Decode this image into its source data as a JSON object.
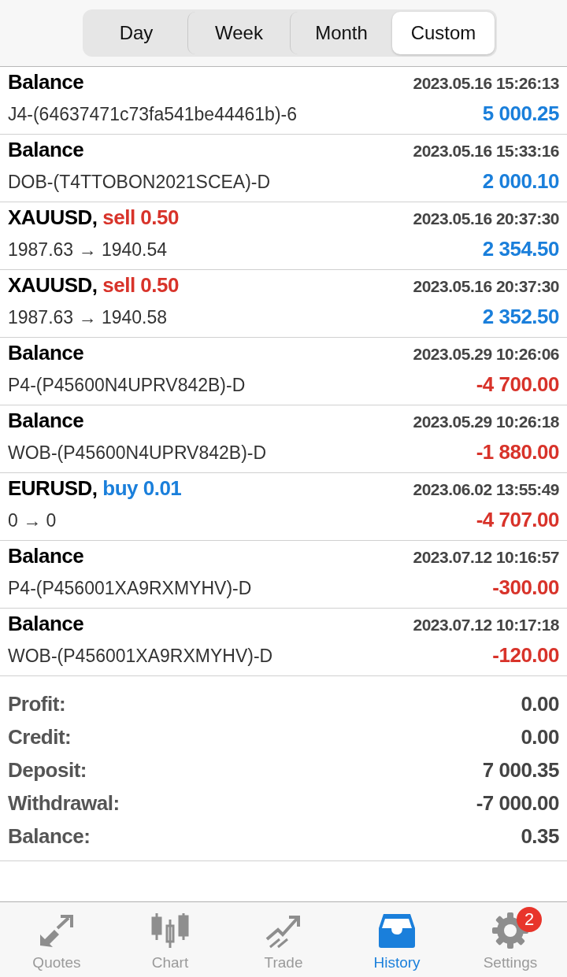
{
  "period_tabs": [
    {
      "label": "Day",
      "selected": false
    },
    {
      "label": "Week",
      "selected": false
    },
    {
      "label": "Month",
      "selected": false
    },
    {
      "label": "Custom",
      "selected": true
    }
  ],
  "deals": [
    {
      "title": "Balance",
      "time": "2023.05.16 15:26:13",
      "comment": "J4-(64637471c73fa541be44461b)-6",
      "amount": "5 000.25",
      "negative": false
    },
    {
      "title": "Balance",
      "time": "2023.05.16 15:33:16",
      "comment": "DOB-(T4TTOBON2021SCEA)-D",
      "amount": "2 000.10",
      "negative": false
    },
    {
      "title": "XAUUSD,",
      "order": {
        "sell": true,
        "text": "sell 0.50"
      },
      "time": "2023.05.16 20:37:30",
      "comment": "1987.63 → 1940.54",
      "amount": "2 354.50",
      "negative": false
    },
    {
      "title": "XAUUSD,",
      "order": {
        "sell": true,
        "text": "sell 0.50"
      },
      "time": "2023.05.16 20:37:30",
      "comment": "1987.63 → 1940.58",
      "amount": "2 352.50",
      "negative": false
    },
    {
      "title": "Balance",
      "time": "2023.05.29 10:26:06",
      "comment": "P4-(P45600N4UPRV842B)-D",
      "amount": "-4 700.00",
      "negative": true
    },
    {
      "title": "Balance",
      "time": "2023.05.29 10:26:18",
      "comment": "WOB-(P45600N4UPRV842B)-D",
      "amount": "-1 880.00",
      "negative": true
    },
    {
      "title": "EURUSD,",
      "order": {
        "sell": false,
        "text": "buy 0.01"
      },
      "time": "2023.06.02 13:55:49",
      "comment": "0 → 0",
      "amount": "-4 707.00",
      "negative": true
    },
    {
      "title": "Balance",
      "time": "2023.07.12 10:16:57",
      "comment": "P4-(P456001XA9RXMYHV)-D",
      "amount": "-300.00",
      "negative": true
    },
    {
      "title": "Balance",
      "time": "2023.07.12 10:17:18",
      "comment": "WOB-(P456001XA9RXMYHV)-D",
      "amount": "-120.00",
      "negative": true
    }
  ],
  "summary": [
    {
      "label": "Profit:",
      "value": "0.00"
    },
    {
      "label": "Credit:",
      "value": "0.00"
    },
    {
      "label": "Deposit:",
      "value": "7 000.35"
    },
    {
      "label": "Withdrawal:",
      "value": "-7 000.00"
    },
    {
      "label": "Balance:",
      "value": "0.35"
    }
  ],
  "tab_bar": [
    {
      "kind": "quotes",
      "label": "Quotes",
      "selected": false
    },
    {
      "kind": "chart",
      "label": "Chart",
      "selected": false
    },
    {
      "kind": "trade",
      "label": "Trade",
      "selected": false
    },
    {
      "kind": "history",
      "label": "History",
      "selected": true
    },
    {
      "kind": "settings",
      "label": "Settings",
      "selected": false,
      "badge": "2"
    }
  ]
}
